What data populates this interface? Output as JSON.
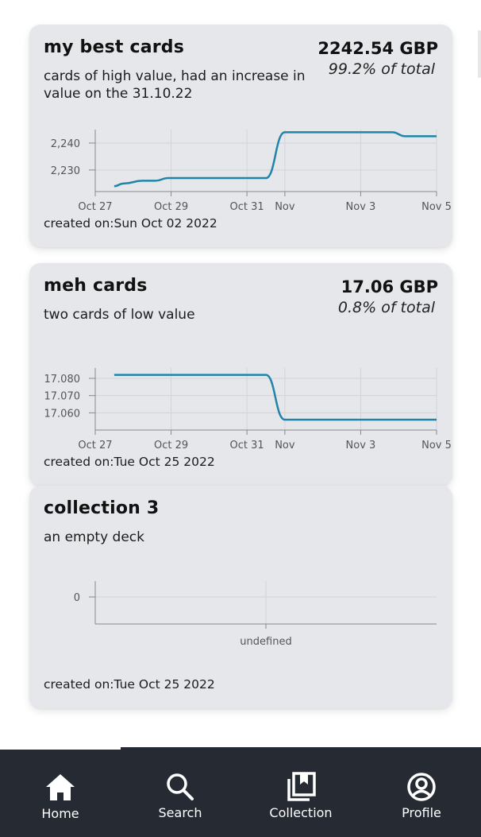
{
  "collections": [
    {
      "title": "my best cards",
      "description": "cards of high value, had an increase in value on the 31.10.22",
      "value": "2242.54 GBP",
      "percent": "99.2% of total",
      "created": "created on:Sun Oct 02 2022",
      "chart_data": {
        "type": "line",
        "x_ticks": [
          "Oct 27",
          "Oct 29",
          "Oct 31",
          "Nov",
          "Nov 3",
          "Nov 5"
        ],
        "y_ticks": [
          "2,230",
          "2,240"
        ],
        "ylim": [
          2222,
          2245
        ],
        "x": [
          "2022-10-27 12:00",
          "2022-10-27 18:00",
          "2022-10-28 06:00",
          "2022-10-28 14:00",
          "2022-10-28 22:00",
          "2022-10-31 12:00",
          "2022-11-01 00:00",
          "2022-11-03 20:00",
          "2022-11-04 04:00",
          "2022-11-05 00:00"
        ],
        "y": [
          2224,
          2225,
          2226,
          2226,
          2227,
          2227,
          2244,
          2244,
          2242.54,
          2242.54
        ],
        "line_color": "#1f84a8",
        "grid": true
      }
    },
    {
      "title": "meh cards",
      "description": "two cards of low value",
      "value": "17.06 GBP",
      "percent": "0.8% of total",
      "created": "created on:Tue Oct 25 2022",
      "chart_data": {
        "type": "line",
        "x_ticks": [
          "Oct 27",
          "Oct 29",
          "Oct 31",
          "Nov",
          "Nov 3",
          "Nov 5"
        ],
        "y_ticks": [
          "17.060",
          "17.070",
          "17.080"
        ],
        "ylim": [
          17.05,
          17.086
        ],
        "x": [
          "2022-10-27 12:00",
          "2022-10-31 12:00",
          "2022-11-01 00:00",
          "2022-11-05 00:00"
        ],
        "y": [
          17.082,
          17.082,
          17.056,
          17.056
        ],
        "line_color": "#1f84a8",
        "grid": true
      }
    },
    {
      "title": "collection 3",
      "description": "an empty deck",
      "value": "",
      "percent": "",
      "created": "created on:Tue Oct 25 2022",
      "chart_data": {
        "type": "line",
        "x_ticks": [
          "undefined"
        ],
        "y_ticks": [
          "0"
        ],
        "x": [],
        "y": [],
        "grid": true
      }
    }
  ],
  "nav": {
    "items": [
      {
        "label": "Home",
        "icon": "home-icon",
        "active": true
      },
      {
        "label": "Search",
        "icon": "search-icon",
        "active": false
      },
      {
        "label": "Collection",
        "icon": "collection-icon",
        "active": false
      },
      {
        "label": "Profile",
        "icon": "profile-icon",
        "active": false
      }
    ],
    "background": "#262a33"
  }
}
